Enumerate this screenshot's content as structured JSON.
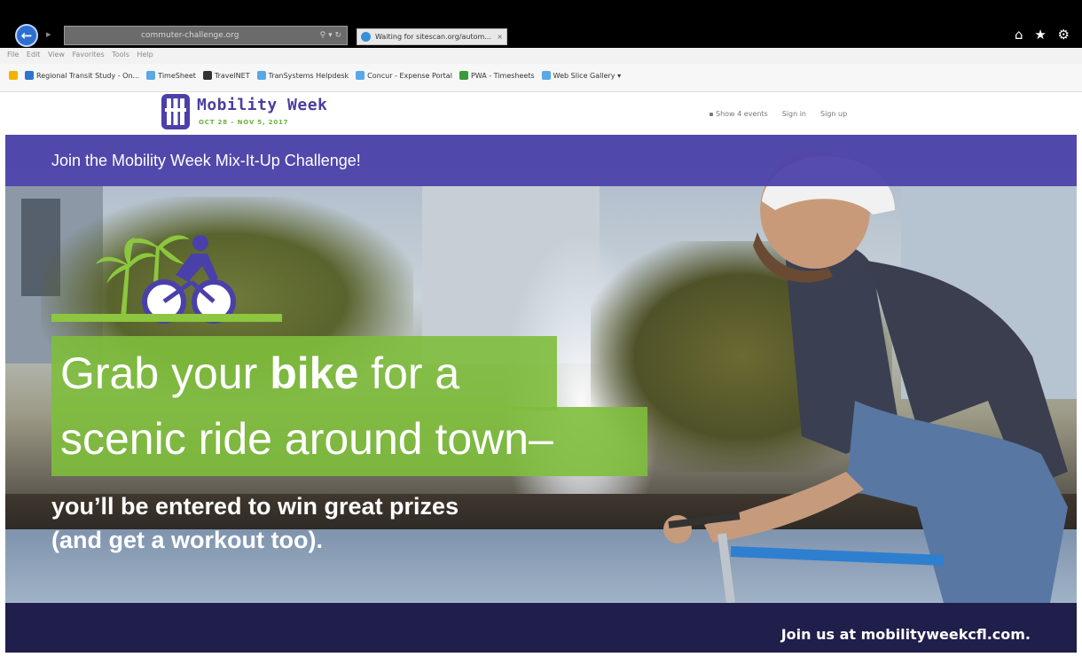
{
  "browser": {
    "back_glyph": "←",
    "forward_glyph": "▸",
    "address": "commuter-challenge.org",
    "address_controls": "⚲ ▾ ↻",
    "tab_title": "Waiting for sitescan.org/autom...",
    "tab_close": "×",
    "toolbar_icons": "⌂ ★ ⚙",
    "menu": "File Edit View Favorites Tools Help",
    "favorites": [
      {
        "label": "Regional Transit Study - On...",
        "color": "#2f74d0"
      },
      {
        "label": "TimeSheet",
        "color": "#5aa8e6"
      },
      {
        "label": "TravelNET",
        "color": "#333333"
      },
      {
        "label": "TranSystems Helpdesk",
        "color": "#5aa8e6"
      },
      {
        "label": "Concur - Expense Portal",
        "color": "#5aa8e6"
      },
      {
        "label": "PWA - Timesheets",
        "color": "#3a9a3a"
      },
      {
        "label": "Web Slice Gallery ▾",
        "color": "#5aa8e6"
      }
    ]
  },
  "site": {
    "logo_title": "Mobility Week",
    "logo_dates": "OCT 28 – NOV 5, 2017",
    "nav": [
      "Show 4 events",
      "Sign in",
      "Sign up"
    ]
  },
  "hero": {
    "banner": "Join the Mobility Week Mix-It-Up Challenge!",
    "headline_pre": "Grab your ",
    "headline_bold": "bike",
    "headline_post": " for a",
    "headline_line2": "scenic ride around town–",
    "subline_1": "you’ll be entered to win great prizes",
    "subline_2": "(and get a workout too)."
  },
  "footer": {
    "text": "Join us at mobilityweekcfl.com."
  },
  "colors": {
    "purple": "#4a40aa",
    "green": "#8dc63f",
    "navy": "#201e4a"
  }
}
